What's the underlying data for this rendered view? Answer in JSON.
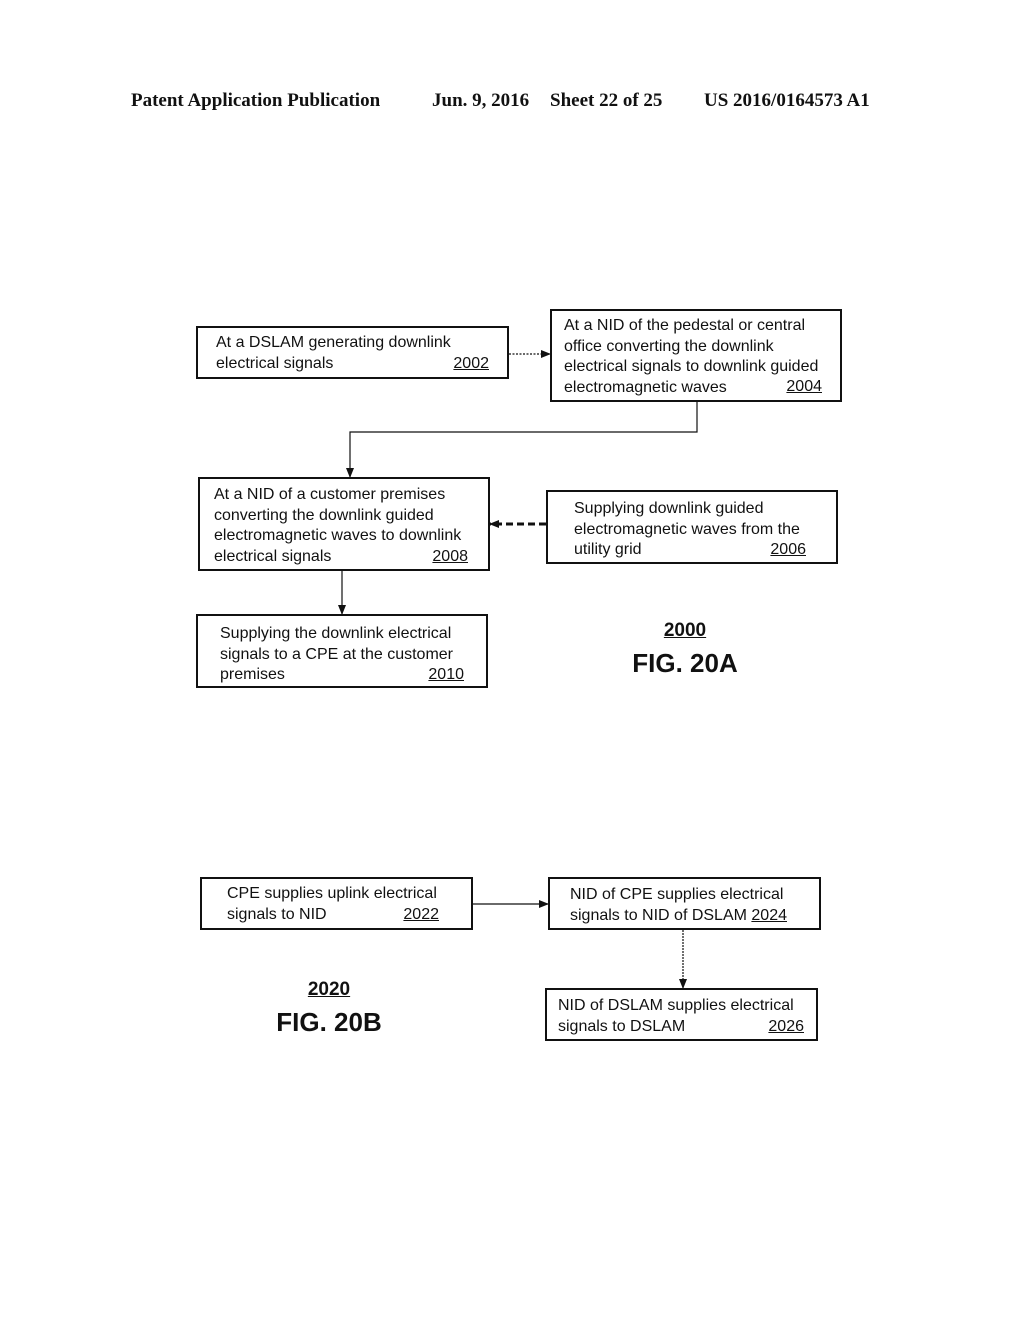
{
  "header": {
    "publication": "Patent Application Publication",
    "date": "Jun. 9, 2016",
    "sheet": "Sheet 22 of 25",
    "number": "US 2016/0164573 A1"
  },
  "fig20a": {
    "ref": "2000",
    "title": "FIG. 20A",
    "steps": {
      "s2002": {
        "lines": [
          "At a DSLAM generating downlink",
          "electrical signals"
        ],
        "ref": "2002"
      },
      "s2004": {
        "lines": [
          "At a NID of the pedestal or central",
          "office converting the downlink",
          "electrical signals to downlink guided",
          "electromagnetic waves"
        ],
        "ref": "2004"
      },
      "s2006": {
        "lines": [
          "Supplying downlink guided",
          "electromagnetic waves from the",
          "utility grid"
        ],
        "ref": "2006"
      },
      "s2008": {
        "lines": [
          "At a NID of a customer premises",
          "converting the downlink guided",
          "electromagnetic waves to downlink",
          "electrical signals"
        ],
        "ref": "2008"
      },
      "s2010": {
        "lines": [
          "Supplying the downlink electrical",
          "signals to a CPE at the customer",
          "premises"
        ],
        "ref": "2010"
      }
    },
    "edges": [
      {
        "from": "2002",
        "to": "2004",
        "style": "dotted"
      },
      {
        "from": "2004",
        "to": "2008",
        "style": "solid"
      },
      {
        "from": "2006",
        "to": "2008",
        "style": "dashed"
      },
      {
        "from": "2008",
        "to": "2010",
        "style": "solid"
      }
    ]
  },
  "fig20b": {
    "ref": "2020",
    "title": "FIG. 20B",
    "steps": {
      "s2022": {
        "lines": [
          "CPE supplies uplink electrical",
          "signals to NID"
        ],
        "ref": "2022"
      },
      "s2024": {
        "lines": [
          "NID of CPE supplies electrical",
          "signals to NID of DSLAM"
        ],
        "ref": "2024"
      },
      "s2026": {
        "lines": [
          "NID of DSLAM supplies electrical",
          "signals to DSLAM"
        ],
        "ref": "2026"
      }
    },
    "edges": [
      {
        "from": "2022",
        "to": "2024",
        "style": "solid"
      },
      {
        "from": "2024",
        "to": "2026",
        "style": "solid"
      }
    ]
  }
}
